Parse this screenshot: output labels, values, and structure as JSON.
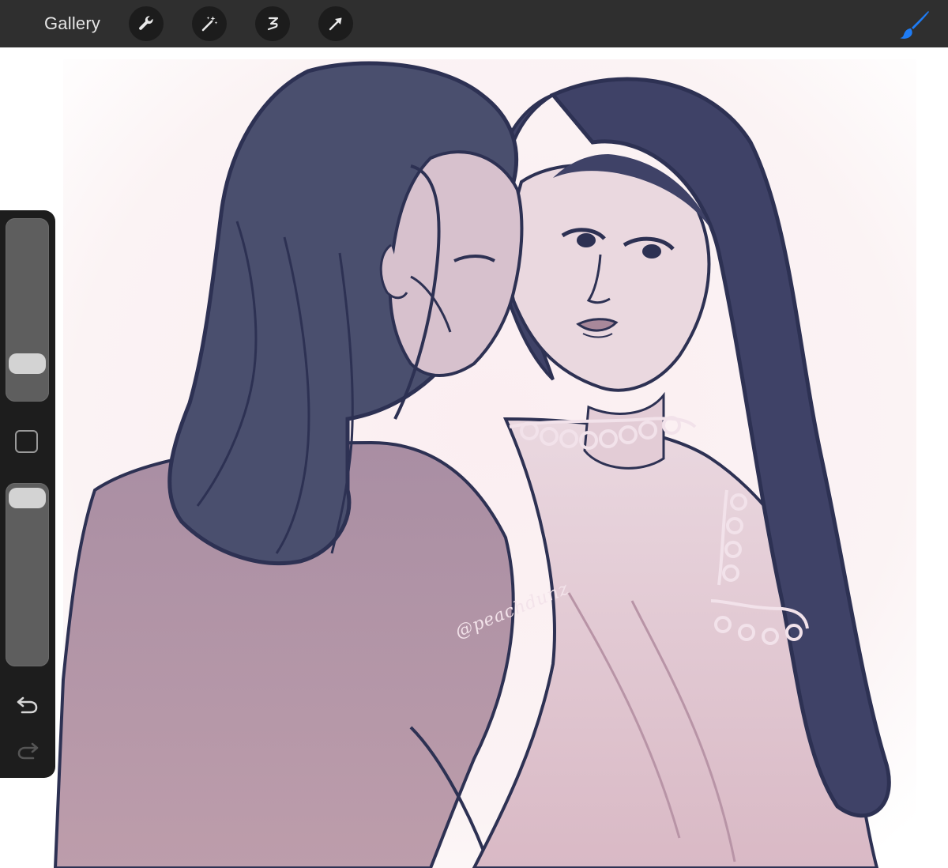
{
  "topbar": {
    "gallery_label": "Gallery",
    "tools": [
      {
        "name": "actions",
        "icon": "wrench-icon"
      },
      {
        "name": "adjustments",
        "icon": "magic-wand-icon"
      },
      {
        "name": "selection",
        "icon": "selection-s-icon"
      },
      {
        "name": "transform",
        "icon": "arrow-cursor-icon"
      }
    ],
    "active_tool": {
      "name": "brush",
      "icon": "brush-icon",
      "color": "#1e7cf5"
    }
  },
  "sidebar": {
    "brush_size_level": 0.15,
    "opacity_level": 1.0,
    "controls": [
      "brush-size-slider",
      "modify-button",
      "opacity-slider",
      "undo-icon",
      "redo-icon"
    ]
  },
  "canvas": {
    "artwork": "two-figures-sketch",
    "signature_text": "@peachdunz",
    "palette": {
      "line": "#2d3153",
      "hair": "#4a4f6e",
      "cloak": "#b798a8",
      "skin": "#e8d2dc",
      "lace": "#f2e2ea",
      "bg_tint": "#fbf1f3"
    }
  }
}
